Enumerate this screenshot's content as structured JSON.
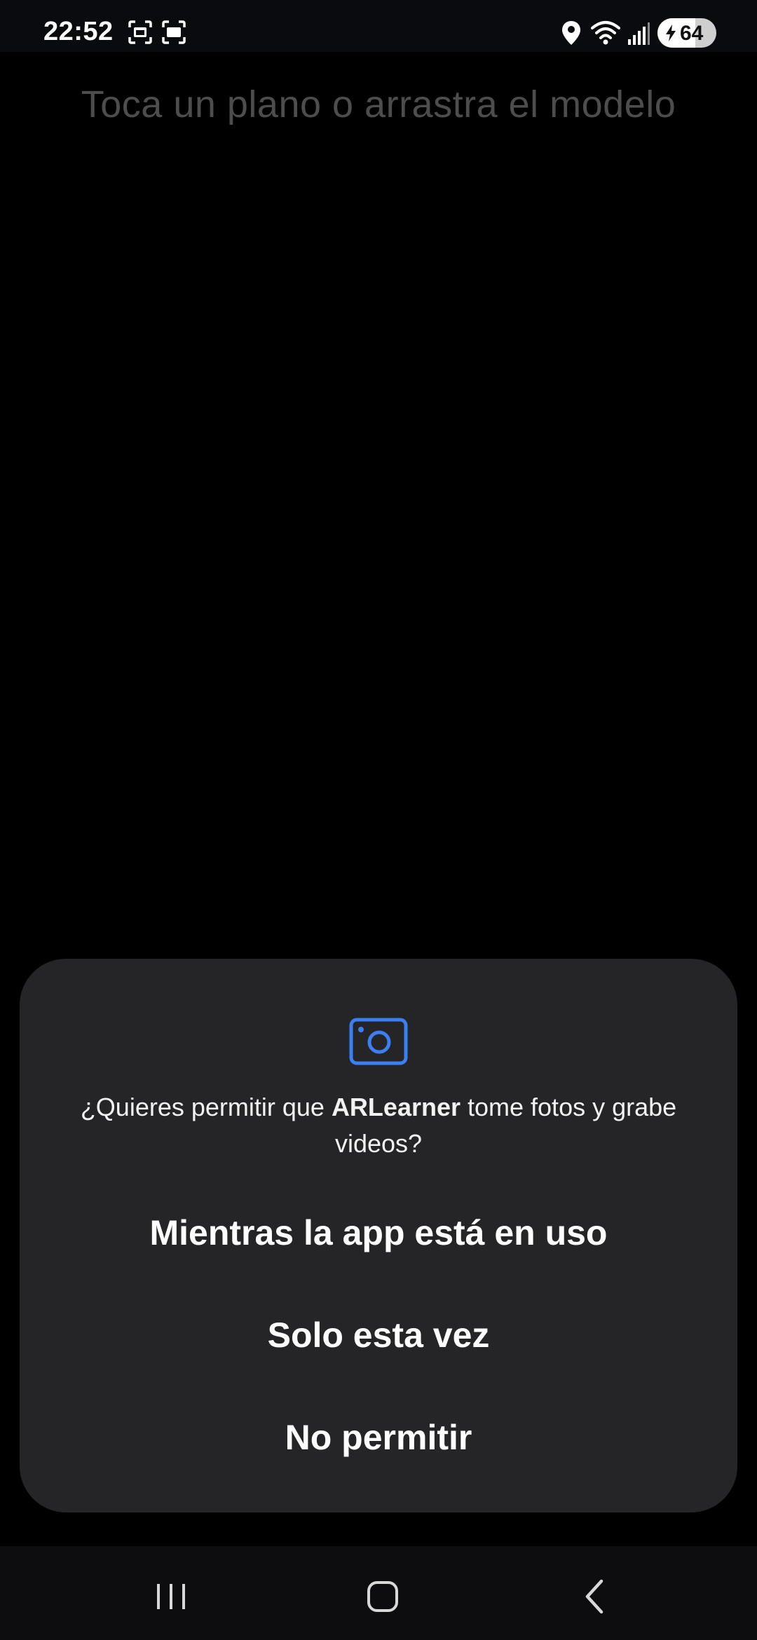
{
  "status_bar": {
    "time": "22:52",
    "battery_level": "64",
    "battery_fraction": 0.64,
    "icons": [
      "screenshot-icon",
      "screen-record-icon",
      "location-icon",
      "wifi-icon",
      "signal-icon",
      "charging-bolt-icon"
    ]
  },
  "hint": {
    "text": "Toca un plano o arrastra el modelo"
  },
  "dialog": {
    "icon": "camera-icon",
    "message_prefix": "¿Quieres permitir que ",
    "app_name": "ARLearner",
    "message_suffix": " tome fotos y grabe videos?",
    "buttons": [
      "Mientras la app está en uso",
      "Solo esta vez",
      "No permitir"
    ],
    "accent_color": "#3b7ff2"
  },
  "nav_bar": {
    "buttons": [
      "recent-apps-icon",
      "home-icon",
      "back-icon"
    ]
  }
}
